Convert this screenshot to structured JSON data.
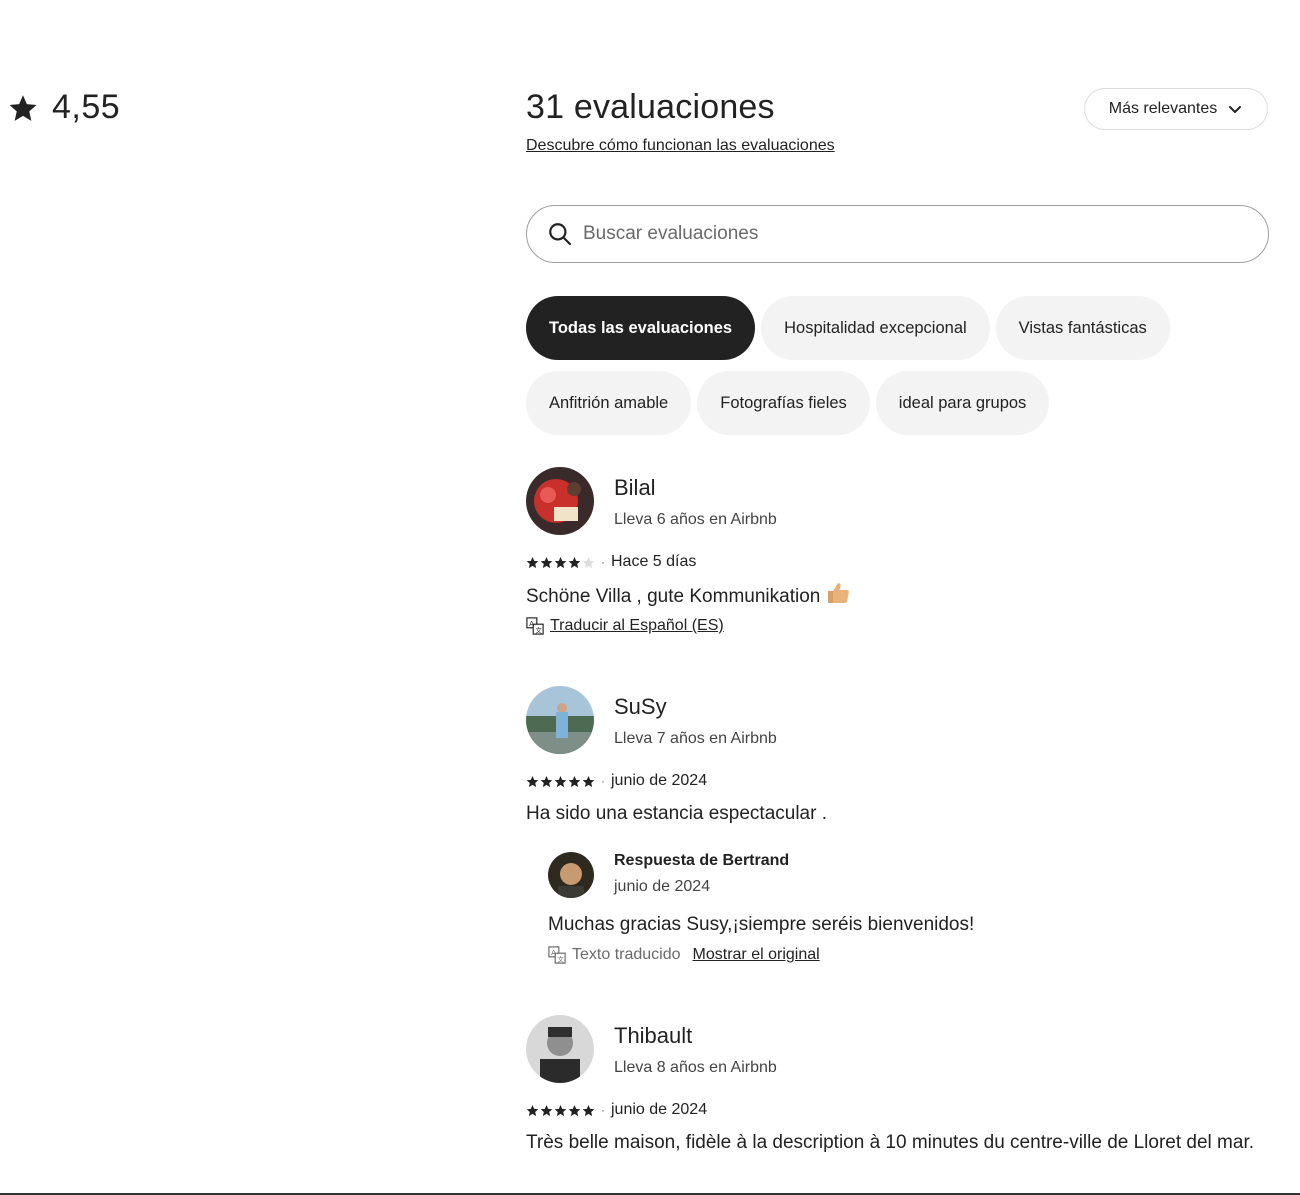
{
  "overall": {
    "icon": "star-icon",
    "rating": "4,55"
  },
  "header": {
    "count_title": "31 evaluaciones",
    "how_link": "Descubre cómo funcionan las evaluaciones",
    "sort_label": "Más relevantes"
  },
  "search": {
    "placeholder": "Buscar evaluaciones"
  },
  "chips": {
    "row1": [
      "Todas las evaluaciones",
      "Hospitalidad excepcional",
      "Vistas fantásticas"
    ],
    "row2": [
      "Anfitrión amable",
      "Fotografías fieles",
      "ideal para grupos"
    ],
    "active": "Todas las evaluaciones"
  },
  "reviews": [
    {
      "name": "Bilal",
      "meta": "Lleva 6 años en Airbnb",
      "rating": 4,
      "date": "Hace 5 días",
      "text": "Schöne Villa , gute Kommunikation",
      "translate_link": "Traducir al Español (ES)"
    },
    {
      "name": "SuSy",
      "meta": "Lleva 7 años en Airbnb",
      "rating": 5,
      "date": "junio de 2024",
      "text": "Ha sido una estancia espectacular .",
      "response": {
        "title": "Respuesta de Bertrand",
        "date": "junio de 2024",
        "text": "Muchas gracias Susy,¡siempre seréis bienvenidos!",
        "translated_label": "Texto traducido",
        "show_original": "Mostrar el original"
      }
    },
    {
      "name": "Thibault",
      "meta": "Lleva 8 años en Airbnb",
      "rating": 5,
      "date": "junio de 2024",
      "text": "Très belle maison, fidèle à la description à 10 minutes du centre-ville de Lloret del mar."
    }
  ],
  "colors": {
    "text": "#222222",
    "chip_bg": "#f3f3f3",
    "chip_active_bg": "#222222",
    "muted": "#6a6a6a"
  }
}
